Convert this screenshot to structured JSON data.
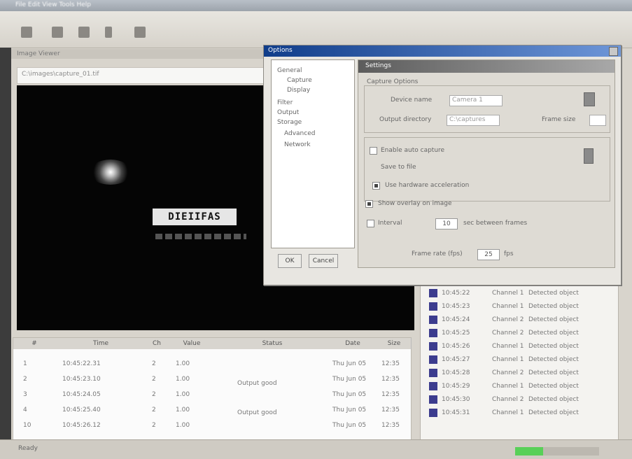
{
  "window": {
    "title": "File   Edit   View   Tools   Help"
  },
  "toolbar": {
    "icons": [
      "open-icon",
      "save-icon",
      "print-icon",
      "cut-icon",
      "settings-icon"
    ]
  },
  "panel": {
    "header": "Image Viewer",
    "path": "C:\\images\\capture_01.tif"
  },
  "view": {
    "label": "DIEIIFAS"
  },
  "table": {
    "headers": [
      "#",
      "Time",
      "Ch",
      "Value",
      "Status",
      "Date",
      "Size"
    ],
    "rows": [
      [
        "1",
        "10:45:22.31",
        "2",
        "1.00",
        "",
        "Thu Jun 05",
        "12:35"
      ],
      [
        "2",
        "10:45:23.10",
        "2",
        "1.00",
        "",
        "Thu Jun 05",
        "12:35"
      ],
      [
        "3",
        "10:45:24.05",
        "2",
        "1.00",
        "",
        "Thu Jun 05",
        "12:35"
      ],
      [
        "4",
        "10:45:25.40",
        "2",
        "1.00",
        "",
        "Thu Jun 05",
        "12:35"
      ],
      [
        "10",
        "10:45:26.12",
        "2",
        "1.00",
        "",
        "Thu Jun 05",
        "12:35"
      ]
    ],
    "merged_status": [
      "Output good",
      "Output good"
    ]
  },
  "log": {
    "rows": [
      [
        "10:45:22",
        "Channel 1",
        "Detected object"
      ],
      [
        "10:45:23",
        "Channel 1",
        "Detected object"
      ],
      [
        "10:45:24",
        "Channel 2",
        "Detected object"
      ],
      [
        "10:45:25",
        "Channel 2",
        "Detected object"
      ],
      [
        "10:45:26",
        "Channel 1",
        "Detected object"
      ],
      [
        "10:45:27",
        "Channel 1",
        "Detected object"
      ],
      [
        "10:45:28",
        "Channel 2",
        "Detected object"
      ],
      [
        "10:45:29",
        "Channel 1",
        "Detected object"
      ],
      [
        "10:45:30",
        "Channel 2",
        "Detected object"
      ],
      [
        "10:45:31",
        "Channel 1",
        "Detected object"
      ]
    ]
  },
  "status": {
    "text": "Ready",
    "progress": 0.33
  },
  "dialog": {
    "title": "Options",
    "tree": [
      "General",
      "Capture",
      "Display",
      "Filter",
      "Output",
      "Storage",
      "Advanced",
      "Network"
    ],
    "ok_label": "OK",
    "cancel_label": "Cancel",
    "section": "Settings",
    "group_label": "Capture Options",
    "name_label": "Device name",
    "name_value": "Camera 1",
    "path_label": "Output directory",
    "path_value": "C:\\captures",
    "size_label": "Frame size",
    "opt1": "Enable auto capture",
    "opt2": "Save to file",
    "opt3": "Use hardware acceleration",
    "opt4": "Show overlay on image",
    "opt5": "Interval",
    "opt5_unit": "sec between frames",
    "spin1": "10",
    "rate_label": "Frame rate (fps)",
    "spin2": "25",
    "rate_unit": "fps"
  }
}
